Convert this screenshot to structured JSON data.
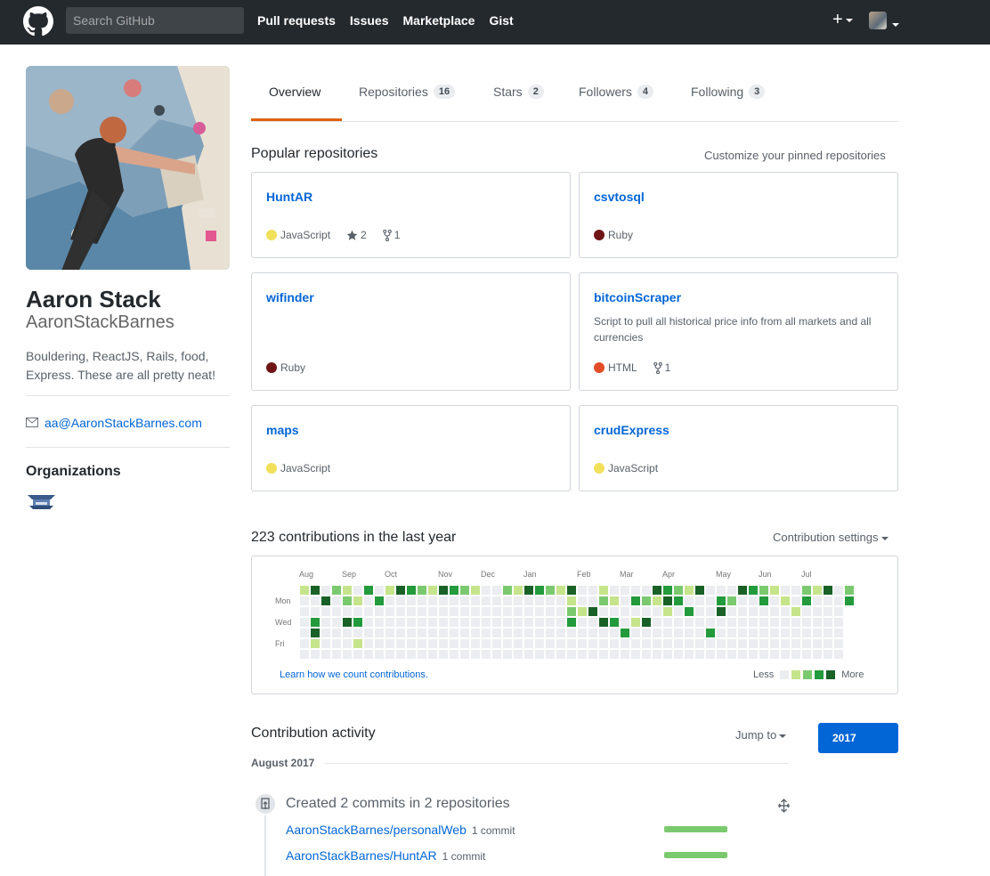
{
  "header": {
    "search_placeholder": "Search GitHub",
    "nav": [
      "Pull requests",
      "Issues",
      "Marketplace",
      "Gist"
    ],
    "plus_label": "+"
  },
  "profile": {
    "fullname": "Aaron Stack",
    "username": "AaronStackBarnes",
    "bio": "Bouldering, ReactJS, Rails, food, Express. These are all pretty neat!",
    "email": "aa@AaronStackBarnes.com",
    "organizations_title": "Organizations"
  },
  "tabs": [
    {
      "label": "Overview",
      "count": ""
    },
    {
      "label": "Repositories",
      "count": "16"
    },
    {
      "label": "Stars",
      "count": "2"
    },
    {
      "label": "Followers",
      "count": "4"
    },
    {
      "label": "Following",
      "count": "3"
    }
  ],
  "popular": {
    "title": "Popular repositories",
    "customize": "Customize your pinned repositories",
    "repos": [
      {
        "name": "HuntAR",
        "description": "",
        "language": "JavaScript",
        "lang_color": "#f1e05a",
        "stars": "2",
        "forks": "1"
      },
      {
        "name": "csvtosql",
        "description": "",
        "language": "Ruby",
        "lang_color": "#701516",
        "stars": "",
        "forks": ""
      },
      {
        "name": "wifinder",
        "description": "",
        "language": "Ruby",
        "lang_color": "#701516",
        "stars": "",
        "forks": ""
      },
      {
        "name": "bitcoinScraper",
        "description": "Script to pull all historical price info from all markets and all currencies",
        "language": "HTML",
        "lang_color": "#e34c26",
        "stars": "",
        "forks": "1"
      },
      {
        "name": "maps",
        "description": "",
        "language": "JavaScript",
        "lang_color": "#f1e05a",
        "stars": "",
        "forks": ""
      },
      {
        "name": "crudExpress",
        "description": "",
        "language": "JavaScript",
        "lang_color": "#f1e05a",
        "stars": "",
        "forks": ""
      }
    ]
  },
  "contributions": {
    "title": "223 contributions in the last year",
    "settings": "Contribution settings",
    "months": [
      "Aug",
      "Sep",
      "Oct",
      "Nov",
      "Dec",
      "Jan",
      "Feb",
      "Mar",
      "Apr",
      "May",
      "Jun",
      "Jul"
    ],
    "days": [
      "Mon",
      "Wed",
      "Fri"
    ],
    "learn": "Learn how we count contributions.",
    "less": "Less",
    "more": "More",
    "colors": [
      "#ebedf0",
      "#c6e48b",
      "#7bc96f",
      "#239a3b",
      "#196127"
    ],
    "level_hex": "1,b9,2,1,b,2a,1,2,1,1,1,1,1,1,1,1,1,0,0,1,1,1,1,1,1,f,4,4,b,a,10,a,a,3,7,3,5,1,10,6,2,1,1,3,1,2,4,3,1,1,0,3"
  },
  "activity": {
    "title": "Contribution activity",
    "jump_to": "Jump to",
    "year": "2017",
    "month": "August 2017",
    "summary": "Created 2 commits in 2 repositories",
    "commits": [
      {
        "repo": "AaronStackBarnes/personalWeb",
        "count": "1 commit",
        "share": 1.0
      },
      {
        "repo": "AaronStackBarnes/HuntAR",
        "count": "1 commit",
        "share": 1.0
      }
    ]
  }
}
